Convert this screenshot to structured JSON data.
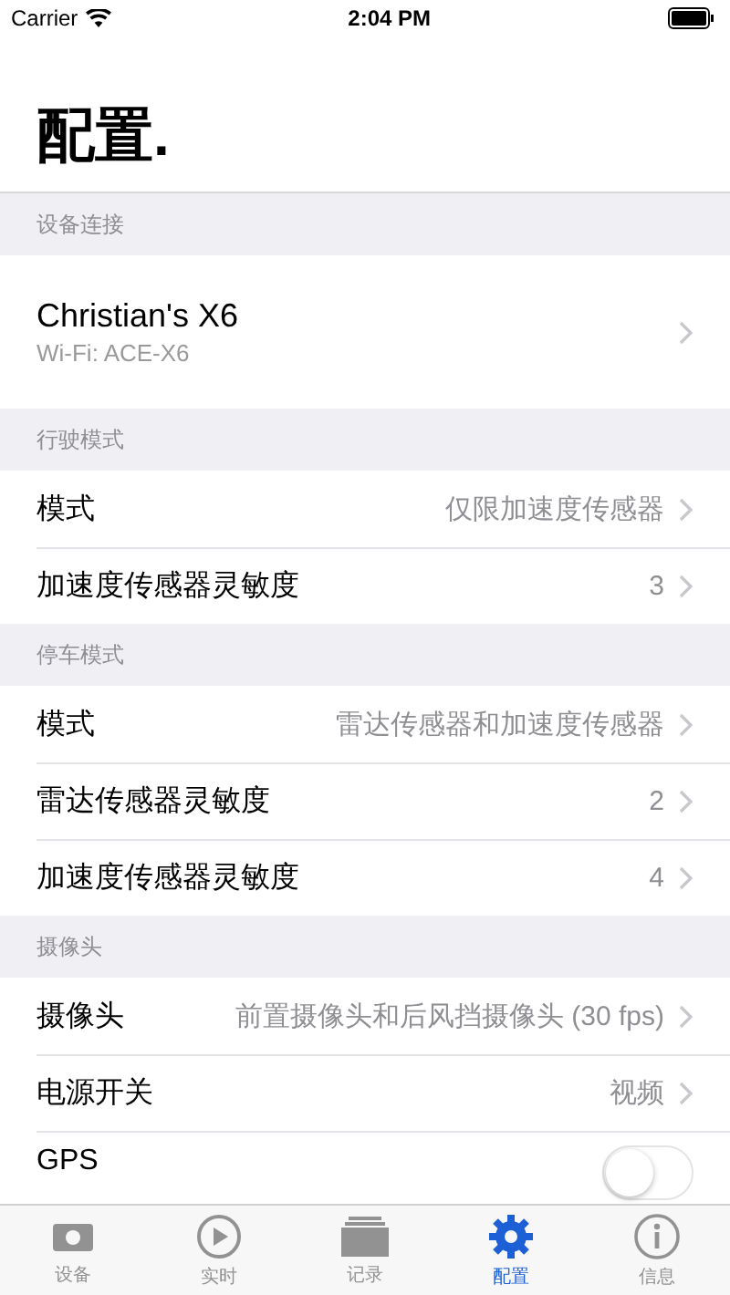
{
  "status_bar": {
    "carrier": "Carrier",
    "time": "2:04 PM"
  },
  "title": "配置.",
  "sections": [
    {
      "header": "设备连接",
      "rows": [
        {
          "kind": "device",
          "label": "Christian's X6",
          "subtitle": "Wi-Fi: ACE-X6"
        }
      ]
    },
    {
      "header": "行驶模式",
      "rows": [
        {
          "kind": "detail",
          "label": "模式",
          "value": "仅限加速度传感器"
        },
        {
          "kind": "detail",
          "label": "加速度传感器灵敏度",
          "value": "3"
        }
      ]
    },
    {
      "header": "停车模式",
      "rows": [
        {
          "kind": "detail",
          "label": "模式",
          "value": "雷达传感器和加速度传感器"
        },
        {
          "kind": "detail",
          "label": "雷达传感器灵敏度",
          "value": "2"
        },
        {
          "kind": "detail",
          "label": "加速度传感器灵敏度",
          "value": "4"
        }
      ]
    },
    {
      "header": "摄像头",
      "rows": [
        {
          "kind": "detail",
          "label": "摄像头",
          "value": "前置摄像头和后风挡摄像头 (30 fps)"
        },
        {
          "kind": "detail",
          "label": "电源开关",
          "value": "视频"
        },
        {
          "kind": "toggle",
          "label": "GPS",
          "on": false
        }
      ]
    }
  ],
  "tabs": [
    {
      "label": "设备",
      "kind": "device",
      "selected": false
    },
    {
      "label": "实时",
      "kind": "play",
      "selected": false
    },
    {
      "label": "记录",
      "kind": "stack",
      "selected": false
    },
    {
      "label": "配置",
      "kind": "gear",
      "selected": true
    },
    {
      "label": "信息",
      "kind": "info",
      "selected": false
    }
  ]
}
